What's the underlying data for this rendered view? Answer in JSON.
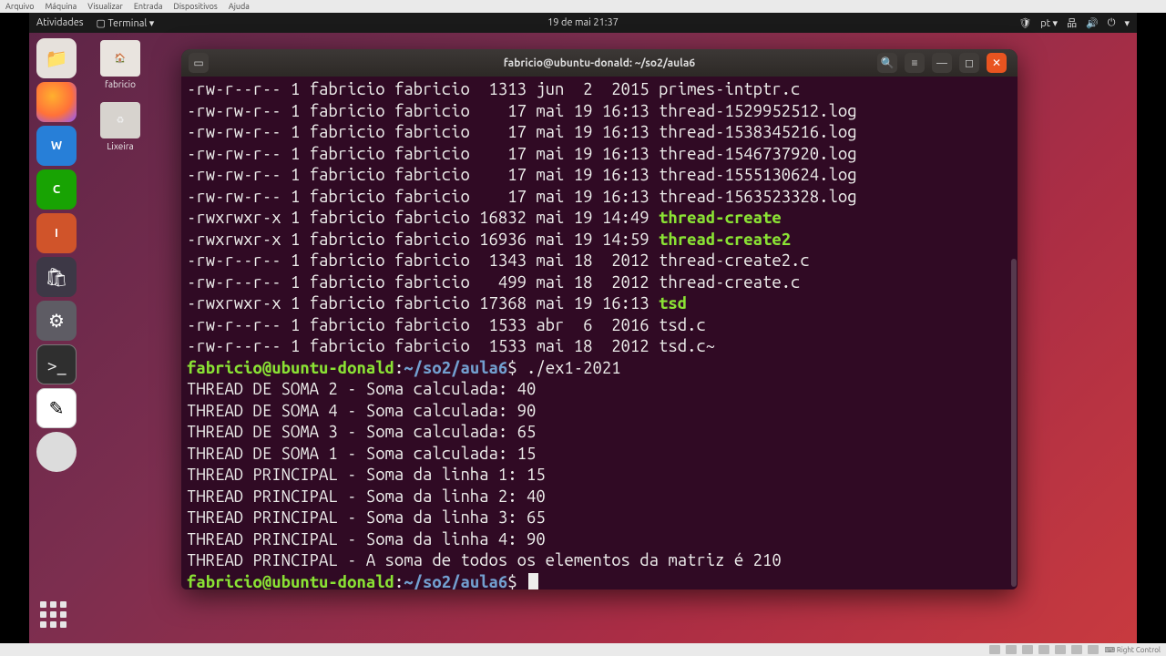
{
  "vm_menu": [
    "Arquivo",
    "Máquina",
    "Visualizar",
    "Entrada",
    "Dispositivos",
    "Ajuda"
  ],
  "topbar": {
    "activities": "Atividades",
    "app": "Terminal ▾",
    "clock": "19 de mai  21:37",
    "lang": "pt ▾"
  },
  "desktop_icons": {
    "home": "fabricio",
    "trash": "Lixeira"
  },
  "terminal": {
    "title": "fabricio@ubuntu-donald: ~/so2/aula6",
    "prompt_user": "fabricio@ubuntu-donald",
    "prompt_path": "~/so2/aula6",
    "command": "./ex1-2021",
    "ls": [
      {
        "perm": "-rw-r--r--",
        "n": "1",
        "u": "fabricio",
        "g": "fabricio",
        "size": " 1313",
        "date": "jun  2  2015",
        "name": "primes-intptr.c"
      },
      {
        "perm": "-rw-rw-r--",
        "n": "1",
        "u": "fabricio",
        "g": "fabricio",
        "size": "   17",
        "date": "mai 19 16:13",
        "name": "thread-1529952512.log"
      },
      {
        "perm": "-rw-rw-r--",
        "n": "1",
        "u": "fabricio",
        "g": "fabricio",
        "size": "   17",
        "date": "mai 19 16:13",
        "name": "thread-1538345216.log"
      },
      {
        "perm": "-rw-rw-r--",
        "n": "1",
        "u": "fabricio",
        "g": "fabricio",
        "size": "   17",
        "date": "mai 19 16:13",
        "name": "thread-1546737920.log"
      },
      {
        "perm": "-rw-rw-r--",
        "n": "1",
        "u": "fabricio",
        "g": "fabricio",
        "size": "   17",
        "date": "mai 19 16:13",
        "name": "thread-1555130624.log"
      },
      {
        "perm": "-rw-rw-r--",
        "n": "1",
        "u": "fabricio",
        "g": "fabricio",
        "size": "   17",
        "date": "mai 19 16:13",
        "name": "thread-1563523328.log"
      },
      {
        "perm": "-rwxrwxr-x",
        "n": "1",
        "u": "fabricio",
        "g": "fabricio",
        "size": "16832",
        "date": "mai 19 14:49",
        "name": "thread-create",
        "exec": true
      },
      {
        "perm": "-rwxrwxr-x",
        "n": "1",
        "u": "fabricio",
        "g": "fabricio",
        "size": "16936",
        "date": "mai 19 14:59",
        "name": "thread-create2",
        "exec": true
      },
      {
        "perm": "-rw-r--r--",
        "n": "1",
        "u": "fabricio",
        "g": "fabricio",
        "size": " 1343",
        "date": "mai 18  2012",
        "name": "thread-create2.c"
      },
      {
        "perm": "-rw-r--r--",
        "n": "1",
        "u": "fabricio",
        "g": "fabricio",
        "size": "  499",
        "date": "mai 18  2012",
        "name": "thread-create.c"
      },
      {
        "perm": "-rwxrwxr-x",
        "n": "1",
        "u": "fabricio",
        "g": "fabricio",
        "size": "17368",
        "date": "mai 19 16:13",
        "name": "tsd",
        "exec": true
      },
      {
        "perm": "-rw-r--r--",
        "n": "1",
        "u": "fabricio",
        "g": "fabricio",
        "size": " 1533",
        "date": "abr  6  2016",
        "name": "tsd.c"
      },
      {
        "perm": "-rw-r--r--",
        "n": "1",
        "u": "fabricio",
        "g": "fabricio",
        "size": " 1533",
        "date": "mai 18  2012",
        "name": "tsd.c~"
      }
    ],
    "output": [
      "THREAD DE SOMA 2 - Soma calculada: 40",
      "THREAD DE SOMA 4 - Soma calculada: 90",
      "THREAD DE SOMA 3 - Soma calculada: 65",
      "THREAD DE SOMA 1 - Soma calculada: 15",
      "THREAD PRINCIPAL - Soma da linha 1: 15",
      "THREAD PRINCIPAL - Soma da linha 2: 40",
      "THREAD PRINCIPAL - Soma da linha 3: 65",
      "THREAD PRINCIPAL - Soma da linha 4: 90",
      "THREAD PRINCIPAL - A soma de todos os elementos da matriz é 210"
    ]
  },
  "statusbar": "Right Control"
}
